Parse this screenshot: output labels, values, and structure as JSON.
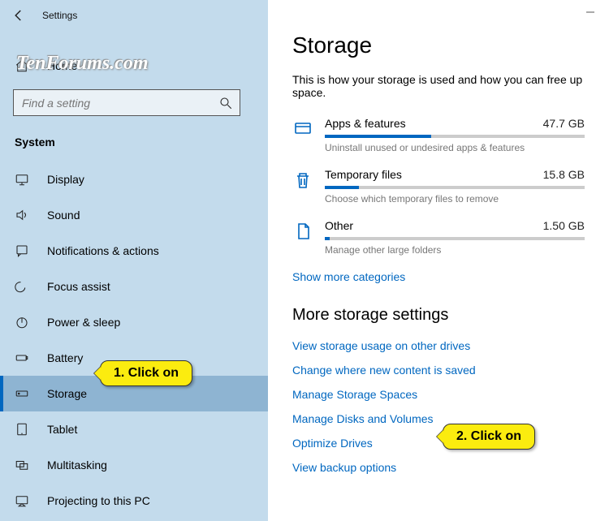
{
  "titlebar": {
    "title": "Settings"
  },
  "sidebar": {
    "home": "Home",
    "search_placeholder": "Find a setting",
    "section": "System",
    "items": [
      {
        "label": "Display"
      },
      {
        "label": "Sound"
      },
      {
        "label": "Notifications & actions"
      },
      {
        "label": "Focus assist"
      },
      {
        "label": "Power & sleep"
      },
      {
        "label": "Battery"
      },
      {
        "label": "Storage"
      },
      {
        "label": "Tablet"
      },
      {
        "label": "Multitasking"
      },
      {
        "label": "Projecting to this PC"
      }
    ]
  },
  "main": {
    "title": "Storage",
    "desc": "This is how your storage is used and how you can free up space.",
    "rows": [
      {
        "name": "Apps & features",
        "size": "47.7 GB",
        "sub": "Uninstall unused or undesired apps & features",
        "pct": 41
      },
      {
        "name": "Temporary files",
        "size": "15.8 GB",
        "sub": "Choose which temporary files to remove",
        "pct": 13
      },
      {
        "name": "Other",
        "size": "1.50 GB",
        "sub": "Manage other large folders",
        "pct": 2
      }
    ],
    "show_more": "Show more categories",
    "more_title": "More storage settings",
    "links": [
      "View storage usage on other drives",
      "Change where new content is saved",
      "Manage Storage Spaces",
      "Manage Disks and Volumes",
      "Optimize Drives",
      "View backup options"
    ]
  },
  "annotations": {
    "callout1": "1. Click on",
    "callout2": "2. Click on"
  },
  "watermark": "TenForums.com"
}
